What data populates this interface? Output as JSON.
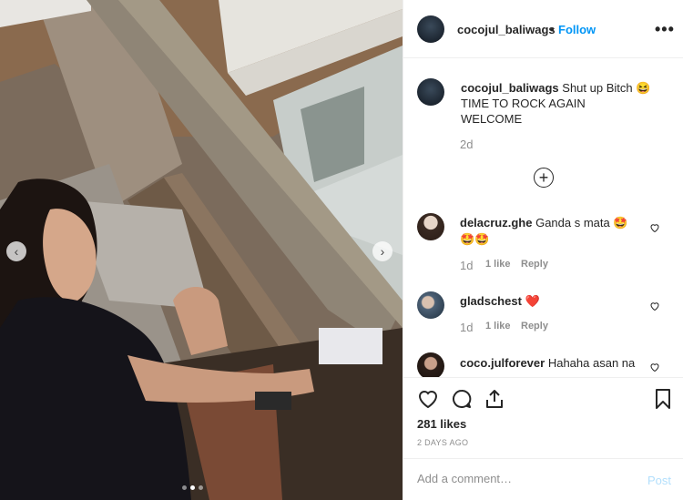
{
  "post": {
    "username": "cocojul_baliwags",
    "separator": "•",
    "follow_label": "Follow",
    "more_label": "•••",
    "caption": {
      "username": "cocojul_baliwags",
      "line1": "Shut up Bitch 😆",
      "line2": "TIME TO ROCK AGAIN",
      "line3": "WELCOME"
    },
    "time_ago": "2d",
    "load_more_label": "+"
  },
  "comments": [
    {
      "username": "delacruz.ghe",
      "text": "Ganda s mata 🤩",
      "text2": "🤩🤩",
      "time": "1d",
      "likes": "1 like",
      "reply_label": "Reply"
    },
    {
      "username": "gladschest",
      "text": "❤️",
      "time": "1d",
      "likes": "1 like",
      "reply_label": "Reply"
    },
    {
      "username": "coco.julforever",
      "text": "Hahaha asan na"
    }
  ],
  "footer": {
    "likes_count": "281 likes",
    "date": "2 DAYS AGO",
    "comment_placeholder": "Add a comment…",
    "post_label": "Post"
  },
  "carousel": {
    "prev_label": "‹",
    "next_label": "›",
    "slides_total": 3,
    "active_slide": 2
  },
  "colors": {
    "link_blue": "#0095f6",
    "post_disabled": "#b2dffc",
    "heart_red": "#ed4956",
    "muted": "#8e8e8e"
  }
}
